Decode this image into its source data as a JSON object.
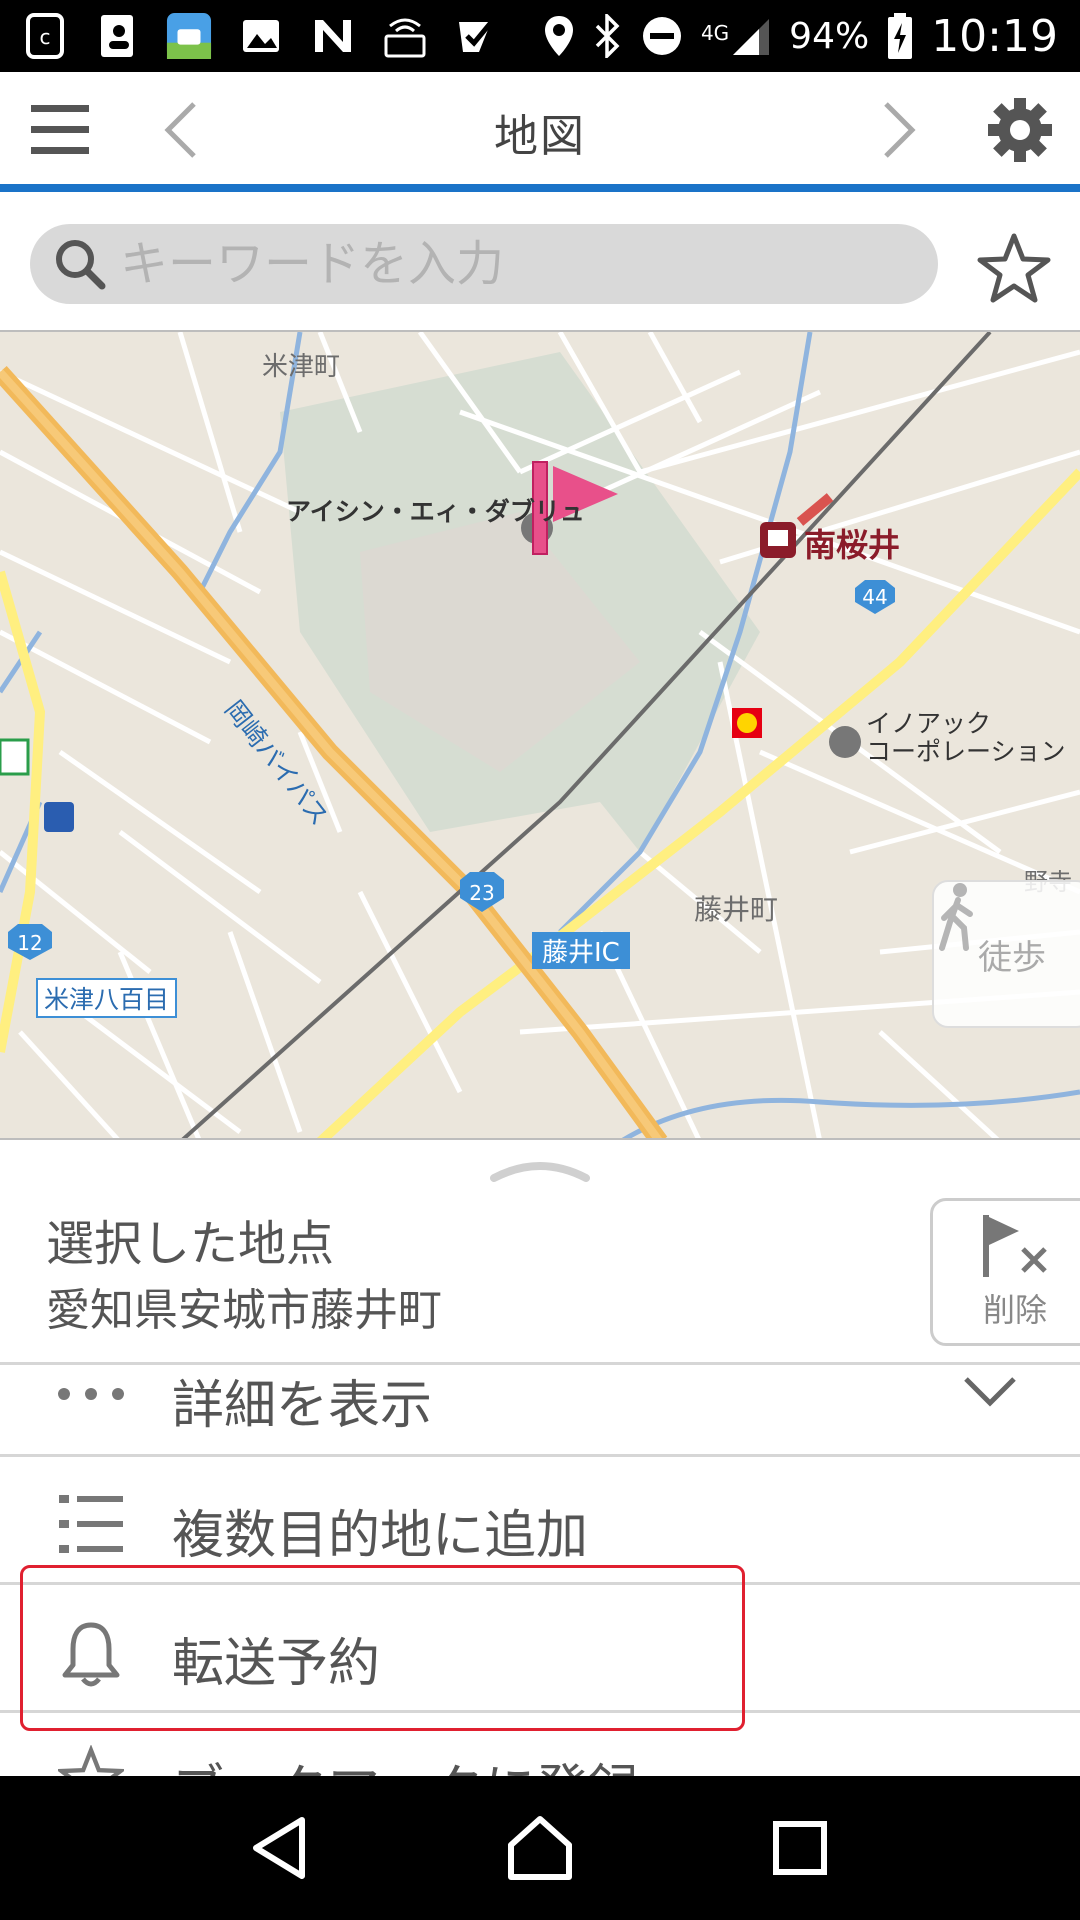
{
  "status_bar": {
    "network": "4G",
    "battery": "94%",
    "time": "10:19"
  },
  "app_bar": {
    "title": "地図"
  },
  "search": {
    "placeholder": "キーワードを入力"
  },
  "map": {
    "labels": {
      "area_yonezu": "米津町",
      "aisin": "アイシン・エィ・ダブリュ",
      "station": "南桜井",
      "route44": "44",
      "company": "イノアック\nコーポレーション",
      "bypass": "岡崎バイパス",
      "route23": "23",
      "fujii_ic": "藤井IC",
      "fujii_town": "藤井町",
      "route12": "12",
      "yonezu8": "米津八百目",
      "nozoku": "野寺"
    },
    "walk_button": "徒歩"
  },
  "sheet": {
    "place_title": "選択した地点",
    "place_address": "愛知県安城市藤井町",
    "delete_label": "削除",
    "menu": [
      {
        "icon": "more-dots-icon",
        "label": "詳細を表示"
      },
      {
        "icon": "list-icon",
        "label": "複数目的地に追加"
      },
      {
        "icon": "bell-icon",
        "label": "転送予約"
      },
      {
        "icon": "star-icon",
        "label": "ブックマークに登録"
      }
    ]
  },
  "colors": {
    "accent": "#1a73c8",
    "highlight": "#e02030",
    "flag": "#e8508a"
  }
}
